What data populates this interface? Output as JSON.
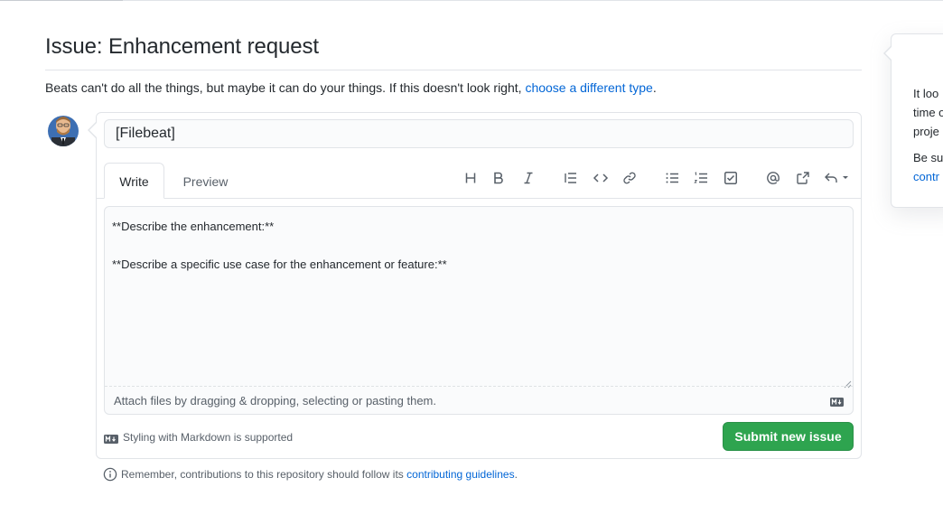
{
  "page": {
    "title": "Issue: Enhancement request",
    "description": "Beats can't do all the things, but maybe it can do your things. If this doesn't look right, ",
    "description_link": "choose a different type",
    "description_end": "."
  },
  "form": {
    "title_value": "[Filebeat]",
    "tabs": [
      {
        "label": "Write",
        "selected": true
      },
      {
        "label": "Preview",
        "selected": false
      }
    ],
    "toolbar": [
      "header-icon",
      "bold-icon",
      "italic-icon",
      "quote-icon",
      "code-icon",
      "link-icon",
      "bulleted-list-icon",
      "numbered-list-icon",
      "task-list-icon",
      "mention-icon",
      "cross-reference-icon",
      "reply-icon"
    ],
    "body_value": "**Describe the enhancement:**\n\n**Describe a specific use case for the enhancement or feature:**",
    "attach_text": "Attach files by dragging & dropping, selecting or pasting them.",
    "markdown_note": "Styling with Markdown is supported",
    "submit_label": "Submit new issue"
  },
  "footer": {
    "remember_text": "Remember, contributions to this repository should follow its ",
    "remember_link": "contributing guidelines",
    "remember_end": "."
  },
  "popover": {
    "line1": "It loo",
    "line2": "time o",
    "line3": "proje",
    "line4": "Be su",
    "line5": "contr"
  },
  "colors": {
    "accent": "#0366d6",
    "submit": "#2ea44f",
    "muted": "#586069"
  }
}
